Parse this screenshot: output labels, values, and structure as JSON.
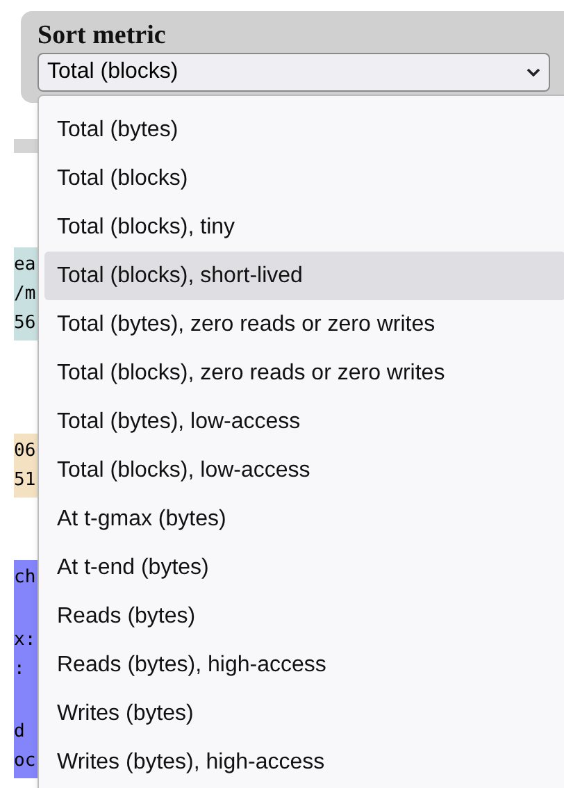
{
  "sort_metric": {
    "label": "Sort metric",
    "value": "Total (blocks)"
  },
  "background_blocks": [
    {
      "kind": "bar",
      "color": "#d4d4d4"
    },
    {
      "kind": "text",
      "color": "#c8e0df",
      "groups": [
        [
          "ea",
          "/m",
          "56"
        ]
      ]
    },
    {
      "kind": "text",
      "color": "#f3e1c2",
      "groups": [
        [
          "06",
          "51"
        ]
      ]
    },
    {
      "kind": "text",
      "color": "#8585fb",
      "groups": [
        [
          "ch"
        ],
        [
          "x:",
          ":"
        ],
        [
          "d",
          "oc"
        ]
      ]
    }
  ],
  "options": [
    {
      "label": "Total (bytes)",
      "selected": false
    },
    {
      "label": "Total (blocks)",
      "selected": false
    },
    {
      "label": "Total (blocks), tiny",
      "selected": false
    },
    {
      "label": "Total (blocks), short-lived",
      "selected": true
    },
    {
      "label": "Total (bytes), zero reads or zero writes",
      "selected": false
    },
    {
      "label": "Total (blocks), zero reads or zero writes",
      "selected": false
    },
    {
      "label": "Total (bytes), low-access",
      "selected": false
    },
    {
      "label": "Total (blocks), low-access",
      "selected": false
    },
    {
      "label": "At t-gmax (bytes)",
      "selected": false
    },
    {
      "label": "At t-end (bytes)",
      "selected": false
    },
    {
      "label": "Reads (bytes)",
      "selected": false
    },
    {
      "label": "Reads (bytes), high-access",
      "selected": false
    },
    {
      "label": "Writes (bytes)",
      "selected": false
    },
    {
      "label": "Writes (bytes), high-access",
      "selected": false
    }
  ]
}
